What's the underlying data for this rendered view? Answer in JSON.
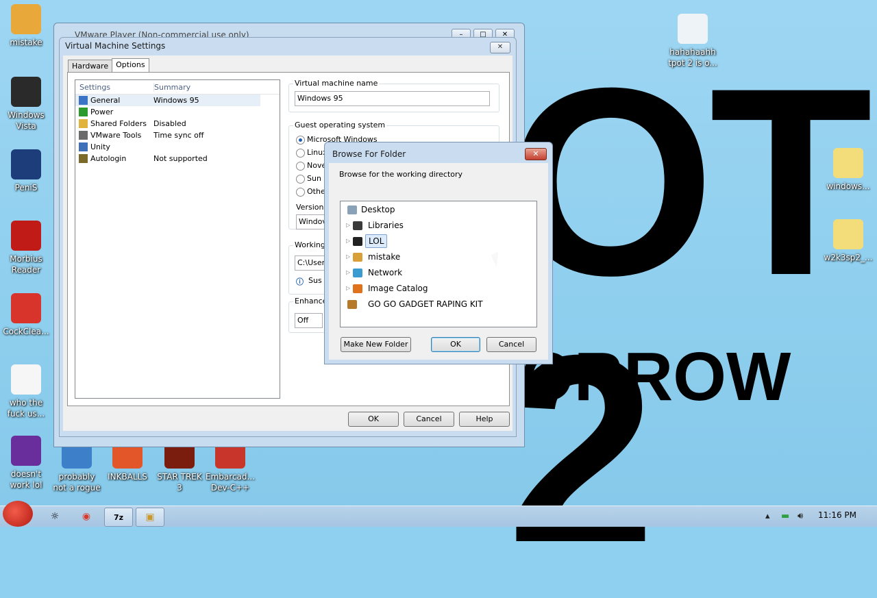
{
  "wallpaper": {
    "big_text": "OT 2",
    "small_text": "ORROW"
  },
  "desktop_icons_left": [
    {
      "label": "mistake",
      "icon": "folder-user-icon",
      "color": "#e9a93a"
    },
    {
      "label": "Windows Vista",
      "icon": "trash-can-icon",
      "color": "#2a2a2a"
    },
    {
      "label": "PeniS",
      "icon": "photoshop-icon",
      "color": "#1c3c7a"
    },
    {
      "label": "Morbius Reader",
      "icon": "pdf-icon",
      "color": "#c11b17"
    },
    {
      "label": "CockClea...",
      "icon": "ccleaner-icon",
      "color": "#d9342b"
    },
    {
      "label": "who the fuck us...",
      "icon": "lightning-icon",
      "color": "#f6f6f6"
    },
    {
      "label": "doesn't work lol",
      "icon": "yahoo-icon",
      "color": "#6a2e9c"
    }
  ],
  "desktop_icons_bottom": [
    {
      "label": "probably not a rogue",
      "icon": "gears-icon",
      "color": "#3d7fc9"
    },
    {
      "label": "INKBALLS",
      "icon": "inkball-icon",
      "color": "#e2562a"
    },
    {
      "label": "STAR TREK 3",
      "icon": "star-wars-icon",
      "color": "#7a1d0f"
    },
    {
      "label": "Embarcad... Dev-C++",
      "icon": "dev-cpp-icon",
      "color": "#c8352a"
    }
  ],
  "desktop_icons_right": [
    {
      "label": "hahahaahh tpot 2 is o...",
      "icon": "tpot-doc-icon",
      "color": "#eef3f8"
    },
    {
      "label": "windows...",
      "icon": "iso-file-icon",
      "color": "#f2dd7a"
    },
    {
      "label": "w2k3sp2_...",
      "icon": "iso-file-icon",
      "color": "#f2dd7a"
    }
  ],
  "vmplayer": {
    "title": "VMware Player (Non-commercial use only)"
  },
  "vm_settings": {
    "title": "Virtual Machine Settings",
    "tabs": [
      "Hardware",
      "Options"
    ],
    "columns": [
      "Settings",
      "Summary"
    ],
    "rows": [
      {
        "setting": "General",
        "summary": "Windows 95",
        "icon_color": "#3b74c5"
      },
      {
        "setting": "Power",
        "summary": "",
        "icon_color": "#2d9a2d"
      },
      {
        "setting": "Shared Folders",
        "summary": "Disabled",
        "icon_color": "#e1b23c"
      },
      {
        "setting": "VMware Tools",
        "summary": "Time sync off",
        "icon_color": "#6b6b6b"
      },
      {
        "setting": "Unity",
        "summary": "",
        "icon_color": "#4070b8"
      },
      {
        "setting": "Autologin",
        "summary": "Not supported",
        "icon_color": "#7b6a2a"
      }
    ],
    "vm_name_label": "Virtual machine name",
    "vm_name_value": "Windows 95",
    "guest_os_label": "Guest operating system",
    "guest_os_options": [
      "Microsoft Windows",
      "Linux",
      "Nove",
      "Sun S",
      "Othe"
    ],
    "version_label": "Version:",
    "version_value": "Windov",
    "working_label": "Working",
    "working_value": "C:\\User",
    "info_text": "Sus",
    "enhanced_label": "Enhance",
    "enhanced_value": "Off",
    "ok": "OK",
    "cancel": "Cancel",
    "help": "Help"
  },
  "browse": {
    "title": "Browse For Folder",
    "prompt": "Browse for the working directory",
    "tree": [
      {
        "label": "Desktop",
        "icon": "desktop-icon",
        "color": "#8aa2b8",
        "expandable": false
      },
      {
        "label": "Libraries",
        "icon": "libraries-icon",
        "color": "#3a3a3a",
        "expandable": true
      },
      {
        "label": "LOL",
        "icon": "user-folder-icon",
        "color": "#222222",
        "expandable": true
      },
      {
        "label": "mistake",
        "icon": "user-folder-icon",
        "color": "#d9a03a",
        "expandable": true
      },
      {
        "label": "Network",
        "icon": "network-icon",
        "color": "#3a9bd0",
        "expandable": true
      },
      {
        "label": "Image Catalog",
        "icon": "image-catalog-icon",
        "color": "#e0721c",
        "expandable": true
      },
      {
        "label": "GO GO GADGET RAPING KIT",
        "icon": "gadget-kit-icon",
        "color": "#b57b2b",
        "expandable": false
      }
    ],
    "make_folder": "Make New Folder",
    "ok": "OK",
    "cancel": "Cancel"
  },
  "taskbar": {
    "clock": "11:16 PM"
  }
}
